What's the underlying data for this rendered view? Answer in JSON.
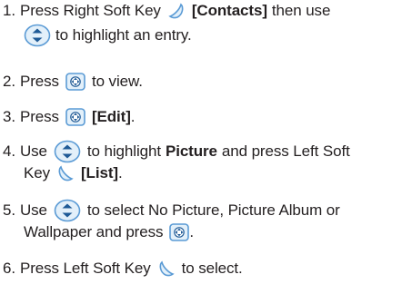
{
  "steps": [
    {
      "num": "1.",
      "line1_text": "Press Right Soft Key",
      "line1_bold": "[Contacts]",
      "line1_tail": "then use",
      "line2_text": "to highlight an entry.",
      "icons": [
        "right-soft-key-icon",
        "nav-updown-key-icon"
      ]
    },
    {
      "num": "2.",
      "text_a": "Press",
      "text_b": "to view.",
      "icons": [
        "ok-key-icon"
      ]
    },
    {
      "num": "3.",
      "text_a": "Press",
      "bold": "[Edit]",
      "tail": ".",
      "icons": [
        "ok-key-icon"
      ]
    },
    {
      "num": "4.",
      "text_a": "Use",
      "text_b": "to highlight",
      "bold_a": "Picture",
      "text_c": "and press Left Soft",
      "line2_text": "Key",
      "bold_b": "[List]",
      "tail": ".",
      "icons": [
        "nav-updown-key-icon",
        "left-soft-key-icon"
      ]
    },
    {
      "num": "5.",
      "text_a": "Use",
      "text_b": "to select No Picture, Picture Album or",
      "line2_text": "Wallpaper and press",
      "tail": ".",
      "icons": [
        "nav-updown-key-icon",
        "ok-key-icon"
      ]
    },
    {
      "num": "6.",
      "text_a": "Press Left Soft Key",
      "text_b": "to select.",
      "icons": [
        "left-soft-key-icon"
      ]
    }
  ],
  "colors": {
    "text": "#231f20",
    "key_outline": "#5b9bd5",
    "key_fill": "#e3f0fa",
    "arrow": "#1f5a96"
  }
}
